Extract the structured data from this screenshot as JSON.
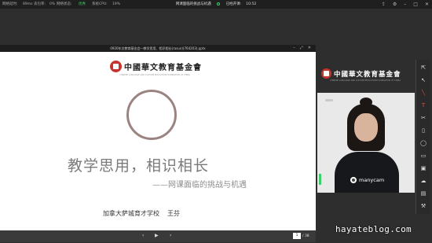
{
  "status_bar": {
    "delay_label": "网络延时:",
    "delay_value": "89ms",
    "loss_label": "丢包率:",
    "loss_value": "0%",
    "net_label": "网络状态:",
    "net_value": "优秀",
    "cpu_label": "系统CPU:",
    "cpu_value": "19%",
    "meeting_title": "网课面临的挑战与机遇",
    "elapsed_label": "已经开课:",
    "elapsed_value": "10:52"
  },
  "presentation": {
    "window_title": "0920年文教育基金会—教学思用、相识相长(rasun)(764203).pptx",
    "slide": {
      "org_name": "中國華文教育基金會",
      "org_name_en": "CHINESE LANGUAGE AND CULTURE EDUCATION FOUNDATION OF CHINA",
      "title": "教学思用，相识相长",
      "subtitle": "——网课面临的挑战与机遇",
      "school": "加拿大萨城育才学校",
      "author": "王芬"
    },
    "page_current": "1",
    "page_total": "/ 38"
  },
  "video": {
    "org_name": "中國華文教育基金會",
    "org_name_en": "CHINESE LANGUAGE AND CULTURE EDUCATION FOUNDATION OF CHINA",
    "cam_label": "manycam"
  },
  "toolbar_icons": [
    "cursor-icon",
    "pointer-icon",
    "pen-icon",
    "text-icon",
    "scissors-icon",
    "eraser-icon",
    "shape-icon",
    "image-icon",
    "screen-icon",
    "cloud-icon",
    "box-icon",
    "tools-icon"
  ],
  "watermark": "hayateblog.com",
  "colors": {
    "accent_green": "#3ccf6a",
    "seal_red": "#c8332d",
    "tool_red": "#e04b3f"
  }
}
